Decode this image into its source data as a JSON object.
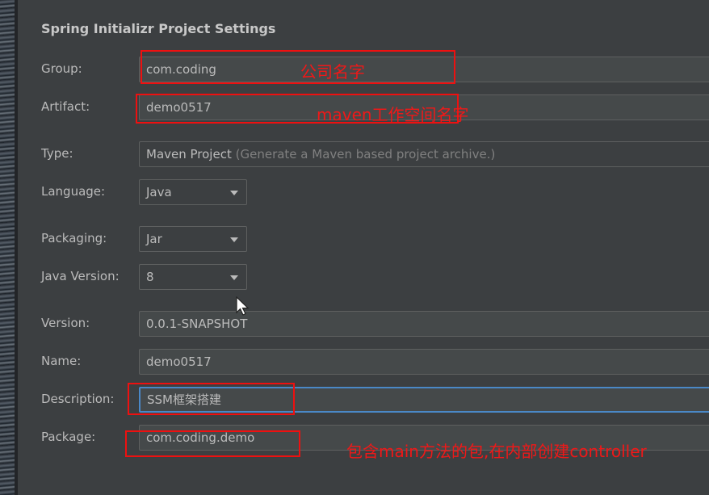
{
  "dialog": {
    "title": "Spring Initializr Project Settings"
  },
  "fields": {
    "group": {
      "label": "Group:",
      "value": "com.coding"
    },
    "artifact": {
      "label": "Artifact:",
      "value": "demo0517"
    },
    "type": {
      "label": "Type:",
      "value": "Maven Project",
      "hint": "(Generate a Maven based project archive.)"
    },
    "language": {
      "label": "Language:",
      "value": "Java"
    },
    "packaging": {
      "label": "Packaging:",
      "value": "Jar"
    },
    "java_version": {
      "label": "Java Version:",
      "value": "8"
    },
    "version": {
      "label": "Version:",
      "value": "0.0.1-SNAPSHOT"
    },
    "name": {
      "label": "Name:",
      "value": "demo0517"
    },
    "description": {
      "label": "Description:",
      "value": "SSM框架搭建"
    },
    "package": {
      "label": "Package:",
      "value": "com.coding.demo"
    }
  },
  "annotations": {
    "group_note": "公司名字",
    "artifact_note": "maven工作空间名字",
    "package_note": "包含main方法的包,在内部创建controller"
  },
  "colors": {
    "annotation": "#ee1010",
    "focus": "#4a88c7",
    "background": "#3c3f41"
  }
}
